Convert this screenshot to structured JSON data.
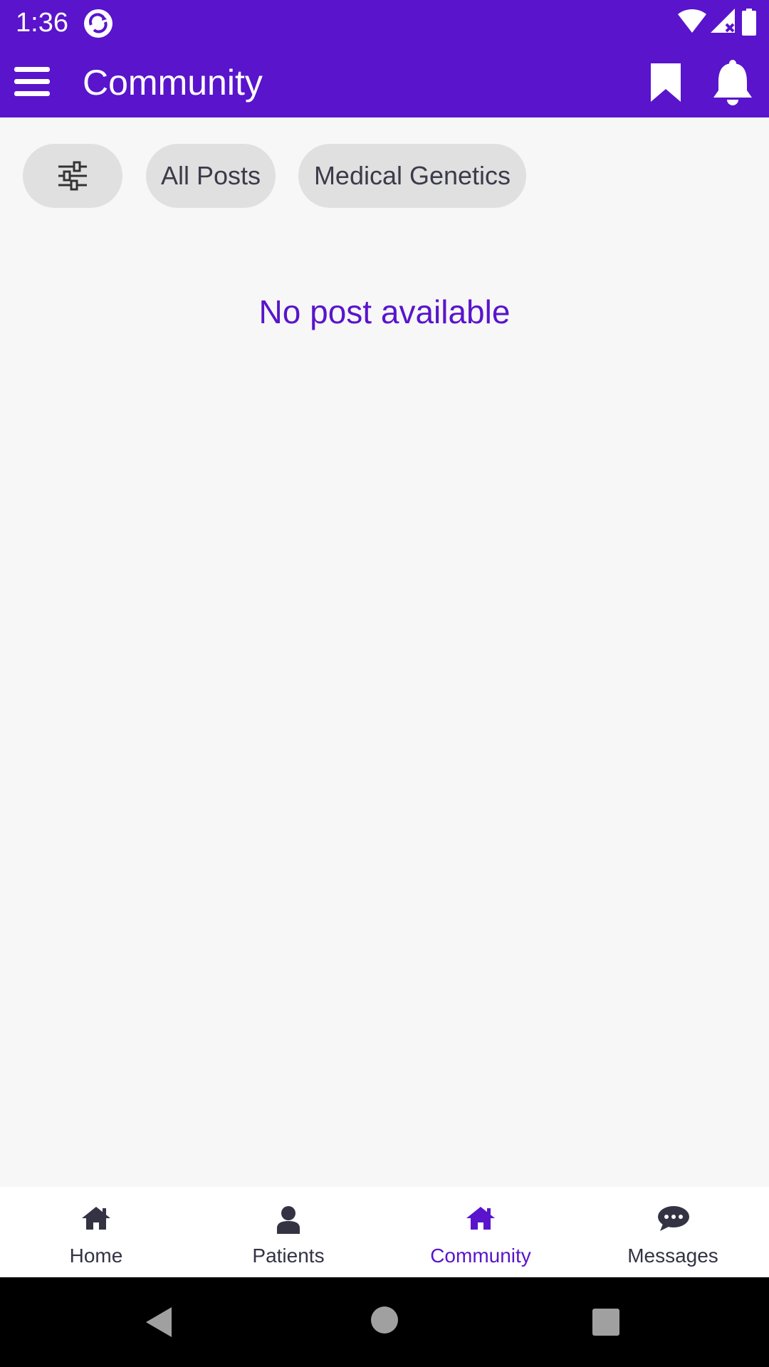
{
  "status_bar": {
    "time": "1:36",
    "icons": [
      "app-sync-icon",
      "wifi-icon",
      "cellular-signal-icon",
      "battery-icon"
    ]
  },
  "app_bar": {
    "title": "Community",
    "icons": [
      "menu-icon",
      "bookmark-icon",
      "bell-icon"
    ],
    "background_color": "#5914cc"
  },
  "filters": {
    "filter_icon": "sliders-icon",
    "chips": [
      {
        "label": "All Posts"
      },
      {
        "label": "Medical Genetics"
      }
    ]
  },
  "content": {
    "empty_message": "No post available"
  },
  "bottom_nav": {
    "items": [
      {
        "label": "Home",
        "icon": "home-icon",
        "active": false
      },
      {
        "label": "Patients",
        "icon": "person-icon",
        "active": false
      },
      {
        "label": "Community",
        "icon": "community-home-icon",
        "active": true
      },
      {
        "label": "Messages",
        "icon": "chat-bubble-icon",
        "active": false
      }
    ],
    "active_color": "#5914cc"
  },
  "system_nav": {
    "icons": [
      "back-icon",
      "home-circle-icon",
      "recents-icon"
    ]
  }
}
